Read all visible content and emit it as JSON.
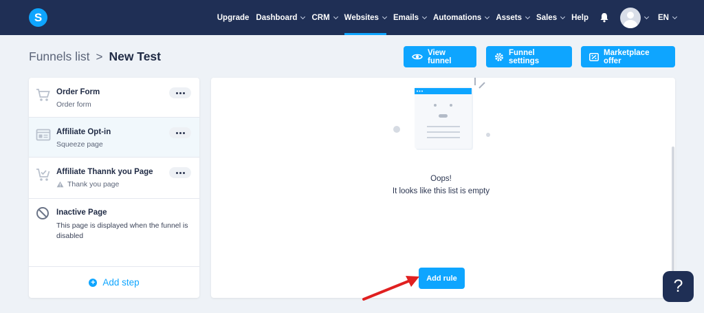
{
  "app": {
    "logo_letter": "S"
  },
  "nav": {
    "items": [
      {
        "label": "Upgrade",
        "dropdown": false,
        "active": false
      },
      {
        "label": "Dashboard",
        "dropdown": true,
        "active": false
      },
      {
        "label": "CRM",
        "dropdown": true,
        "active": false
      },
      {
        "label": "Websites",
        "dropdown": true,
        "active": true
      },
      {
        "label": "Emails",
        "dropdown": true,
        "active": false
      },
      {
        "label": "Automations",
        "dropdown": true,
        "active": false
      },
      {
        "label": "Assets",
        "dropdown": true,
        "active": false
      },
      {
        "label": "Sales",
        "dropdown": true,
        "active": false
      },
      {
        "label": "Help",
        "dropdown": false,
        "active": false
      }
    ],
    "language": "EN"
  },
  "breadcrumb": {
    "root": "Funnels list",
    "separator": ">",
    "current": "New Test"
  },
  "header_buttons": {
    "view_funnel": "View funnel",
    "funnel_settings": "Funnel settings",
    "marketplace_offer": "Marketplace offer"
  },
  "steps": [
    {
      "title": "Order Form",
      "subtitle": "Order form",
      "icon": "cart-icon",
      "selected": false,
      "warning": false
    },
    {
      "title": "Affiliate Opt-in",
      "subtitle": "Squeeze page",
      "icon": "squeeze-page-icon",
      "selected": true,
      "warning": false
    },
    {
      "title": "Affiliate Thannk you Page",
      "subtitle": "Thank you page",
      "icon": "cart-check-icon",
      "selected": false,
      "warning": true
    }
  ],
  "inactive_page": {
    "title": "Inactive Page",
    "description": "This page is displayed when the funnel is disabled"
  },
  "add_step_label": "Add step",
  "empty_state": {
    "line1": "Oops!",
    "line2": "It looks like this list is empty"
  },
  "add_rule_label": "Add rule",
  "help_label": "?",
  "colors": {
    "accent": "#0ea5ff",
    "nav_bg": "#1f2f55",
    "annotation_arrow": "#e02020"
  }
}
